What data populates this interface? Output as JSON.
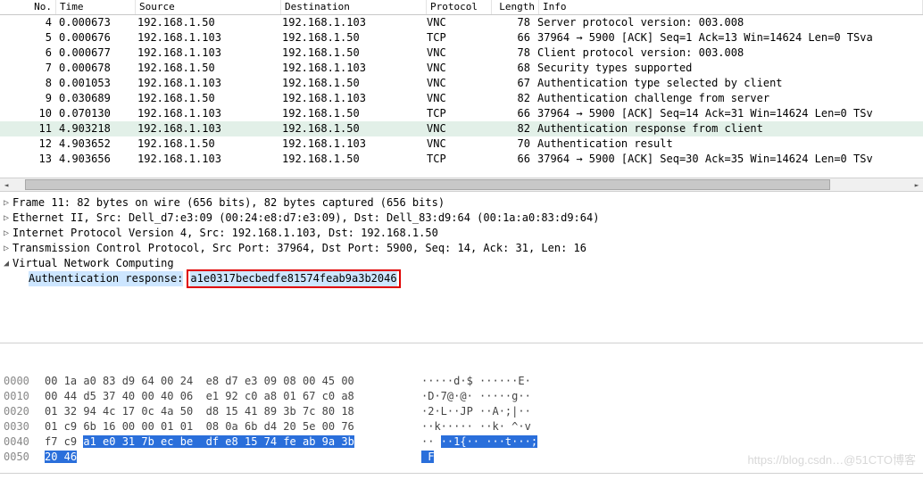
{
  "headers": {
    "no": "No.",
    "time": "Time",
    "source": "Source",
    "destination": "Destination",
    "protocol": "Protocol",
    "length": "Length",
    "info": "Info"
  },
  "rows": [
    {
      "no": "4",
      "time": "0.000673",
      "src": "192.168.1.50",
      "dst": "192.168.1.103",
      "proto": "VNC",
      "len": "78",
      "info": "Server protocol version: 003.008"
    },
    {
      "no": "5",
      "time": "0.000676",
      "src": "192.168.1.103",
      "dst": "192.168.1.50",
      "proto": "TCP",
      "len": "66",
      "info": "37964 → 5900 [ACK] Seq=1 Ack=13 Win=14624 Len=0 TSva"
    },
    {
      "no": "6",
      "time": "0.000677",
      "src": "192.168.1.103",
      "dst": "192.168.1.50",
      "proto": "VNC",
      "len": "78",
      "info": "Client protocol version: 003.008"
    },
    {
      "no": "7",
      "time": "0.000678",
      "src": "192.168.1.50",
      "dst": "192.168.1.103",
      "proto": "VNC",
      "len": "68",
      "info": "Security types supported"
    },
    {
      "no": "8",
      "time": "0.001053",
      "src": "192.168.1.103",
      "dst": "192.168.1.50",
      "proto": "VNC",
      "len": "67",
      "info": "Authentication type selected by client"
    },
    {
      "no": "9",
      "time": "0.030689",
      "src": "192.168.1.50",
      "dst": "192.168.1.103",
      "proto": "VNC",
      "len": "82",
      "info": "Authentication challenge from server"
    },
    {
      "no": "10",
      "time": "0.070130",
      "src": "192.168.1.103",
      "dst": "192.168.1.50",
      "proto": "TCP",
      "len": "66",
      "info": "37964 → 5900 [ACK] Seq=14 Ack=31 Win=14624 Len=0 TSv"
    },
    {
      "no": "11",
      "time": "4.903218",
      "src": "192.168.1.103",
      "dst": "192.168.1.50",
      "proto": "VNC",
      "len": "82",
      "info": "Authentication response from client",
      "selected": true,
      "highlight": true
    },
    {
      "no": "12",
      "time": "4.903652",
      "src": "192.168.1.50",
      "dst": "192.168.1.103",
      "proto": "VNC",
      "len": "70",
      "info": "Authentication result"
    },
    {
      "no": "13",
      "time": "4.903656",
      "src": "192.168.1.103",
      "dst": "192.168.1.50",
      "proto": "TCP",
      "len": "66",
      "info": "37964 → 5900 [ACK] Seq=30 Ack=35 Win=14624 Len=0 TSv"
    }
  ],
  "details": {
    "frame": "Frame 11: 82 bytes on wire (656 bits), 82 bytes captured (656 bits)",
    "eth": "Ethernet II, Src: Dell_d7:e3:09 (00:24:e8:d7:e3:09), Dst: Dell_83:d9:64 (00:1a:a0:83:d9:64)",
    "ip": "Internet Protocol Version 4, Src: 192.168.1.103, Dst: 192.168.1.50",
    "tcp": "Transmission Control Protocol, Src Port: 37964, Dst Port: 5900, Seq: 14, Ack: 31, Len: 16",
    "vnc": "Virtual Network Computing",
    "authLabel": "Authentication response:",
    "authValue": "a1e0317becbedfe81574feab9a3b2046"
  },
  "hex": [
    {
      "off": "0000",
      "b": "00 1a a0 83 d9 64 00 24  e8 d7 e3 09 08 00 45 00",
      "a": "·····d·$ ······E·"
    },
    {
      "off": "0010",
      "b": "00 44 d5 37 40 00 40 06  e1 92 c0 a8 01 67 c0 a8",
      "a": "·D·7@·@· ·····g··"
    },
    {
      "off": "0020",
      "b": "01 32 94 4c 17 0c 4a 50  d8 15 41 89 3b 7c 80 18",
      "a": "·2·L··JP ··A·;|··"
    },
    {
      "off": "0030",
      "b": "01 c9 6b 16 00 00 01 01  08 0a 6b d4 20 5e 00 76",
      "a": "··k····· ··k· ^·v"
    },
    {
      "off": "0040",
      "b": "f7 c9 ",
      "hlstart": true,
      "b2": "a1 e0 31 7b ec be  df e8 15 74 fe ab 9a 3b",
      "a1": "·· ",
      "a2": "··1{·· ···t···;"
    },
    {
      "off": "0050",
      "hl": "20 46",
      "a": " F"
    }
  ],
  "watermark": "https://blog.csdn…@51CTO博客"
}
